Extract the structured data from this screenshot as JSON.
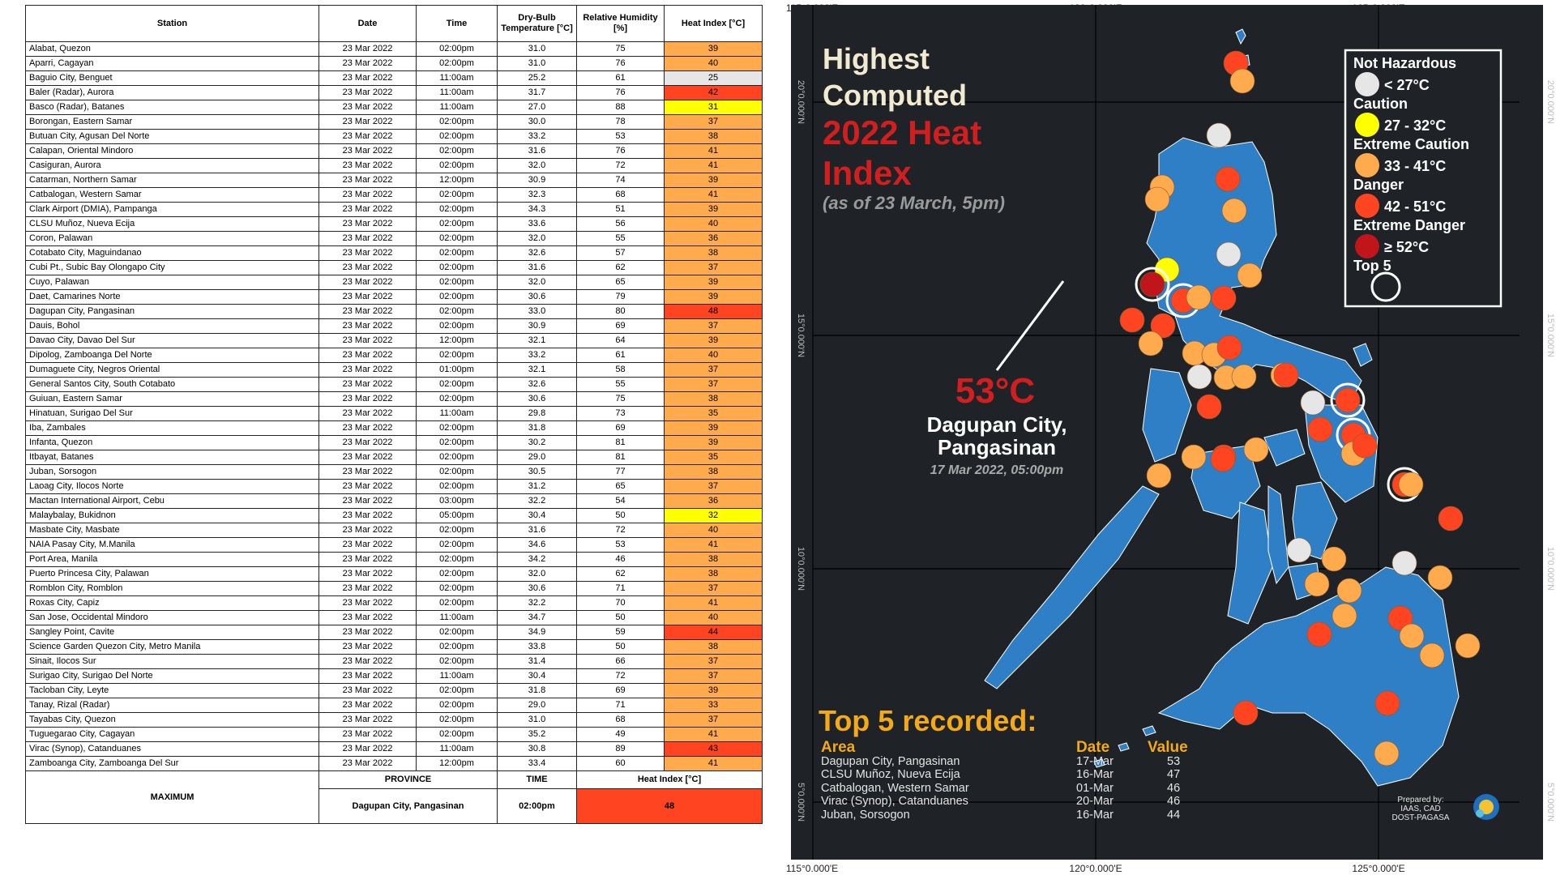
{
  "table": {
    "headers": [
      "Station",
      "Date",
      "Time",
      "Dry-Bulb Temperature [°C]",
      "Relative Humidity [%]",
      "Heat Index [°C]"
    ],
    "rows": [
      [
        "Alabat, Quezon",
        "23 Mar 2022",
        "02:00pm",
        "31.0",
        "75",
        "39"
      ],
      [
        "Aparri, Cagayan",
        "23 Mar 2022",
        "02:00pm",
        "31.0",
        "76",
        "40"
      ],
      [
        "Baguio City, Benguet",
        "23 Mar 2022",
        "11:00am",
        "25.2",
        "61",
        "25"
      ],
      [
        "Baler (Radar), Aurora",
        "23 Mar 2022",
        "11:00am",
        "31.7",
        "76",
        "42"
      ],
      [
        "Basco (Radar), Batanes",
        "23 Mar 2022",
        "11:00am",
        "27.0",
        "88",
        "31"
      ],
      [
        "Borongan, Eastern Samar",
        "23 Mar 2022",
        "02:00pm",
        "30.0",
        "78",
        "37"
      ],
      [
        "Butuan City, Agusan Del Norte",
        "23 Mar 2022",
        "02:00pm",
        "33.2",
        "53",
        "38"
      ],
      [
        "Calapan, Oriental Mindoro",
        "23 Mar 2022",
        "02:00pm",
        "31.6",
        "76",
        "41"
      ],
      [
        "Casiguran, Aurora",
        "23 Mar 2022",
        "02:00pm",
        "32.0",
        "72",
        "41"
      ],
      [
        "Catarman, Northern Samar",
        "23 Mar 2022",
        "12:00pm",
        "30.9",
        "74",
        "39"
      ],
      [
        "Catbalogan, Western Samar",
        "23 Mar 2022",
        "02:00pm",
        "32.3",
        "68",
        "41"
      ],
      [
        "Clark Airport (DMIA), Pampanga",
        "23 Mar 2022",
        "02:00pm",
        "34.3",
        "51",
        "39"
      ],
      [
        "CLSU Muñoz, Nueva Ecija",
        "23 Mar 2022",
        "02:00pm",
        "33.6",
        "56",
        "40"
      ],
      [
        "Coron, Palawan",
        "23 Mar 2022",
        "02:00pm",
        "32.0",
        "55",
        "36"
      ],
      [
        "Cotabato City, Maguindanao",
        "23 Mar 2022",
        "02:00pm",
        "32.6",
        "57",
        "38"
      ],
      [
        "Cubi Pt., Subic Bay Olongapo City",
        "23 Mar 2022",
        "02:00pm",
        "31.6",
        "62",
        "37"
      ],
      [
        "Cuyo, Palawan",
        "23 Mar 2022",
        "02:00pm",
        "32.0",
        "65",
        "39"
      ],
      [
        "Daet, Camarines Norte",
        "23 Mar 2022",
        "02:00pm",
        "30.6",
        "79",
        "39"
      ],
      [
        "Dagupan City, Pangasinan",
        "23 Mar 2022",
        "02:00pm",
        "33.0",
        "80",
        "48"
      ],
      [
        "Dauis, Bohol",
        "23 Mar 2022",
        "02:00pm",
        "30.9",
        "69",
        "37"
      ],
      [
        "Davao City, Davao Del Sur",
        "23 Mar 2022",
        "12:00pm",
        "32.1",
        "64",
        "39"
      ],
      [
        "Dipolog, Zamboanga Del Norte",
        "23 Mar 2022",
        "02:00pm",
        "33.2",
        "61",
        "40"
      ],
      [
        "Dumaguete City, Negros Oriental",
        "23 Mar 2022",
        "01:00pm",
        "32.1",
        "58",
        "37"
      ],
      [
        "General Santos City, South Cotabato",
        "23 Mar 2022",
        "02:00pm",
        "32.6",
        "55",
        "37"
      ],
      [
        "Guiuan, Eastern Samar",
        "23 Mar 2022",
        "02:00pm",
        "30.6",
        "75",
        "38"
      ],
      [
        "Hinatuan, Surigao Del Sur",
        "23 Mar 2022",
        "11:00am",
        "29.8",
        "73",
        "35"
      ],
      [
        "Iba, Zambales",
        "23 Mar 2022",
        "02:00pm",
        "31.8",
        "69",
        "39"
      ],
      [
        "Infanta, Quezon",
        "23 Mar 2022",
        "02:00pm",
        "30.2",
        "81",
        "39"
      ],
      [
        "Itbayat, Batanes",
        "23 Mar 2022",
        "02:00pm",
        "29.0",
        "81",
        "35"
      ],
      [
        "Juban, Sorsogon",
        "23 Mar 2022",
        "02:00pm",
        "30.5",
        "77",
        "38"
      ],
      [
        "Laoag City, Ilocos Norte",
        "23 Mar 2022",
        "02:00pm",
        "31.2",
        "65",
        "37"
      ],
      [
        "Mactan International Airport, Cebu",
        "23 Mar 2022",
        "03:00pm",
        "32.2",
        "54",
        "36"
      ],
      [
        "Malaybalay, Bukidnon",
        "23 Mar 2022",
        "05:00pm",
        "30.4",
        "50",
        "32"
      ],
      [
        "Masbate City, Masbate",
        "23 Mar 2022",
        "02:00pm",
        "31.6",
        "72",
        "40"
      ],
      [
        "NAIA Pasay City, M.Manila",
        "23 Mar 2022",
        "02:00pm",
        "34.6",
        "53",
        "41"
      ],
      [
        "Port Area, Manila",
        "23 Mar 2022",
        "02:00pm",
        "34.2",
        "46",
        "38"
      ],
      [
        "Puerto Princesa City, Palawan",
        "23 Mar 2022",
        "02:00pm",
        "32.0",
        "62",
        "38"
      ],
      [
        "Romblon City, Romblon",
        "23 Mar 2022",
        "02:00pm",
        "30.6",
        "71",
        "37"
      ],
      [
        "Roxas City, Capiz",
        "23 Mar 2022",
        "02:00pm",
        "32.2",
        "70",
        "41"
      ],
      [
        "San Jose, Occidental Mindoro",
        "23 Mar 2022",
        "11:00am",
        "34.7",
        "50",
        "40"
      ],
      [
        "Sangley Point, Cavite",
        "23 Mar 2022",
        "02:00pm",
        "34.9",
        "59",
        "44"
      ],
      [
        "Science Garden Quezon City, Metro Manila",
        "23 Mar 2022",
        "02:00pm",
        "33.8",
        "50",
        "38"
      ],
      [
        "Sinait, Ilocos Sur",
        "23 Mar 2022",
        "02:00pm",
        "31.4",
        "66",
        "37"
      ],
      [
        "Surigao City, Surigao Del Norte",
        "23 Mar 2022",
        "11:00am",
        "30.4",
        "72",
        "37"
      ],
      [
        "Tacloban City, Leyte",
        "23 Mar 2022",
        "02:00pm",
        "31.8",
        "69",
        "39"
      ],
      [
        "Tanay, Rizal (Radar)",
        "23 Mar 2022",
        "02:00pm",
        "29.0",
        "71",
        "33"
      ],
      [
        "Tayabas City, Quezon",
        "23 Mar 2022",
        "02:00pm",
        "31.0",
        "68",
        "37"
      ],
      [
        "Tuguegarao City, Cagayan",
        "23 Mar 2022",
        "02:00pm",
        "35.2",
        "49",
        "41"
      ],
      [
        "Virac (Synop), Catanduanes",
        "23 Mar 2022",
        "11:00am",
        "30.8",
        "89",
        "43"
      ],
      [
        "Zamboanga City, Zamboanga Del Sur",
        "23 Mar 2022",
        "12:00pm",
        "33.4",
        "60",
        "41"
      ]
    ],
    "footer": {
      "maximum_label": "MAXIMUM",
      "province_header": "PROVINCE",
      "time_header": "TIME",
      "hi_header": "Heat Index [°C]",
      "province": "Dagupan City, Pangasinan",
      "time": "02:00pm",
      "hi": "48"
    }
  },
  "colors": {
    "not_hazardous": "#e6e6e6",
    "caution": "#ffff00",
    "extreme_caution": "#ffaa4c",
    "danger": "#ff4422",
    "extreme_danger": "#c0151b",
    "map_bg": "#1f2226",
    "land": "#2f7fc7",
    "title_red": "#d11f1f",
    "top5_yellow": "#f4a917"
  },
  "map": {
    "title_line1": "Highest",
    "title_line2": "Computed",
    "title_line3": "2022 Heat",
    "title_line4": "Index",
    "subtitle": "(as of 23 March, 5pm)",
    "callout_value": "53°C",
    "callout_place_line1": "Dagupan City,",
    "callout_place_line2": "Pangasinan",
    "callout_time": "17 Mar 2022, 05:00pm",
    "lon_labels": [
      "115°0.000'E",
      "120°0.000'E",
      "125°0.000'E"
    ],
    "lat_labels": [
      "20°0.000'N",
      "15°0.000'N",
      "10°0.000'N",
      "5°0.000'N"
    ],
    "legend": [
      {
        "category": "Not Hazardous",
        "range": "< 27°C",
        "color_key": "not_hazardous"
      },
      {
        "category": "Caution",
        "range": "27 - 32°C",
        "color_key": "caution"
      },
      {
        "category": "Extreme Caution",
        "range": "33 - 41°C",
        "color_key": "extreme_caution"
      },
      {
        "category": "Danger",
        "range": "42 - 51°C",
        "color_key": "danger"
      },
      {
        "category": "Extreme Danger",
        "range": "≥ 52°C",
        "color_key": "extreme_danger"
      },
      {
        "category": "Top 5",
        "range": "",
        "color_key": "top5"
      }
    ],
    "top5_title": "Top 5 recorded:",
    "top5_headers": {
      "area": "Area",
      "date": "Date",
      "value": "Value"
    },
    "top5": [
      {
        "area": "Dagupan City, Pangasinan",
        "date": "17-Mar",
        "value": "53"
      },
      {
        "area": "CLSU Muñoz, Nueva Ecija",
        "date": "16-Mar",
        "value": "47"
      },
      {
        "area": "Catbalogan, Western Samar",
        "date": "01-Mar",
        "value": "46"
      },
      {
        "area": "Virac (Synop), Catanduanes",
        "date": "20-Mar",
        "value": "46"
      },
      {
        "area": "Juban, Sorsogon",
        "date": "16-Mar",
        "value": "44"
      }
    ],
    "prepared_by": [
      "Prepared by:",
      "IAAS, CAD",
      "DOST-PAGASA"
    ],
    "stations": [
      {
        "cat": "danger"
      },
      {
        "cat": "extreme_caution"
      },
      {
        "cat": "not_hazardous"
      },
      {
        "cat": "danger"
      },
      {
        "cat": "extreme_caution"
      },
      {
        "cat": "extreme_caution"
      },
      {
        "cat": "extreme_caution"
      },
      {
        "cat": "not_hazardous"
      },
      {
        "cat": "extreme_caution"
      },
      {
        "cat": "caution"
      },
      {
        "cat": "extreme_danger",
        "top5": true
      },
      {
        "cat": "danger",
        "top5": true
      },
      {
        "cat": "danger"
      },
      {
        "cat": "danger"
      },
      {
        "cat": "danger"
      },
      {
        "cat": "extreme_caution"
      },
      {
        "cat": "extreme_caution"
      },
      {
        "cat": "extreme_caution"
      },
      {
        "cat": "extreme_caution"
      },
      {
        "cat": "danger"
      },
      {
        "cat": "not_hazardous"
      },
      {
        "cat": "extreme_caution"
      },
      {
        "cat": "extreme_caution"
      },
      {
        "cat": "danger"
      },
      {
        "cat": "extreme_caution"
      },
      {
        "cat": "danger"
      },
      {
        "cat": "not_hazardous"
      },
      {
        "cat": "danger",
        "top5": true
      },
      {
        "cat": "danger",
        "top5": true
      },
      {
        "cat": "danger"
      },
      {
        "cat": "extreme_caution"
      },
      {
        "cat": "danger"
      },
      {
        "cat": "danger"
      },
      {
        "cat": "extreme_caution"
      },
      {
        "cat": "danger",
        "top5": true
      },
      {
        "cat": "extreme_caution"
      },
      {
        "cat": "danger"
      },
      {
        "cat": "extreme_caution"
      },
      {
        "cat": "extreme_caution"
      },
      {
        "cat": "danger"
      },
      {
        "cat": "not_hazardous"
      },
      {
        "cat": "extreme_caution"
      },
      {
        "cat": "not_hazardous"
      },
      {
        "cat": "extreme_caution"
      },
      {
        "cat": "extreme_caution"
      },
      {
        "cat": "extreme_caution"
      },
      {
        "cat": "extreme_caution"
      },
      {
        "cat": "danger"
      },
      {
        "cat": "danger"
      },
      {
        "cat": "extreme_caution"
      },
      {
        "cat": "extreme_caution"
      },
      {
        "cat": "extreme_caution"
      },
      {
        "cat": "danger"
      },
      {
        "cat": "danger"
      },
      {
        "cat": "extreme_caution"
      }
    ]
  }
}
